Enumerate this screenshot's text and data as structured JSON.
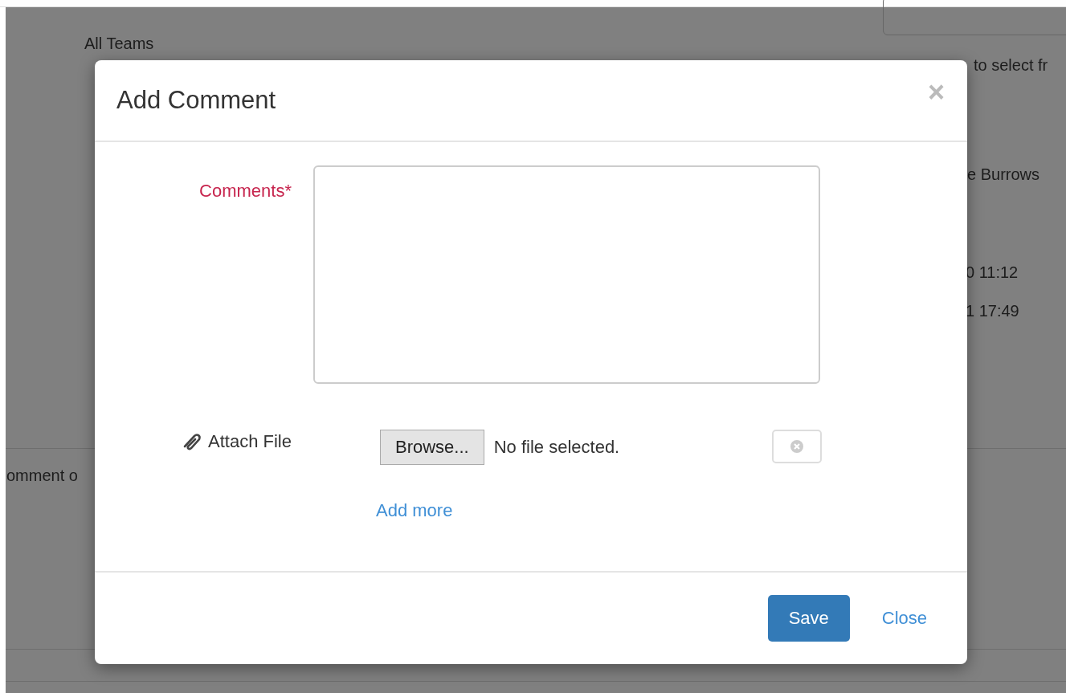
{
  "background": {
    "team_filter": "All Teams",
    "hint": "to select fr",
    "name": "e Burrows",
    "dates": [
      "0 11:12",
      "1 17:49"
    ],
    "comment_label": "omment o"
  },
  "dialog": {
    "title": "Add Comment",
    "close_icon": "×",
    "comments": {
      "label": "Comments*",
      "required": true
    },
    "attachment": {
      "label": "Attach File",
      "browse_button": "Browse...",
      "file_status": "No file selected.",
      "add_more": "Add more"
    },
    "buttons": {
      "save": "Save",
      "close": "Close"
    }
  }
}
